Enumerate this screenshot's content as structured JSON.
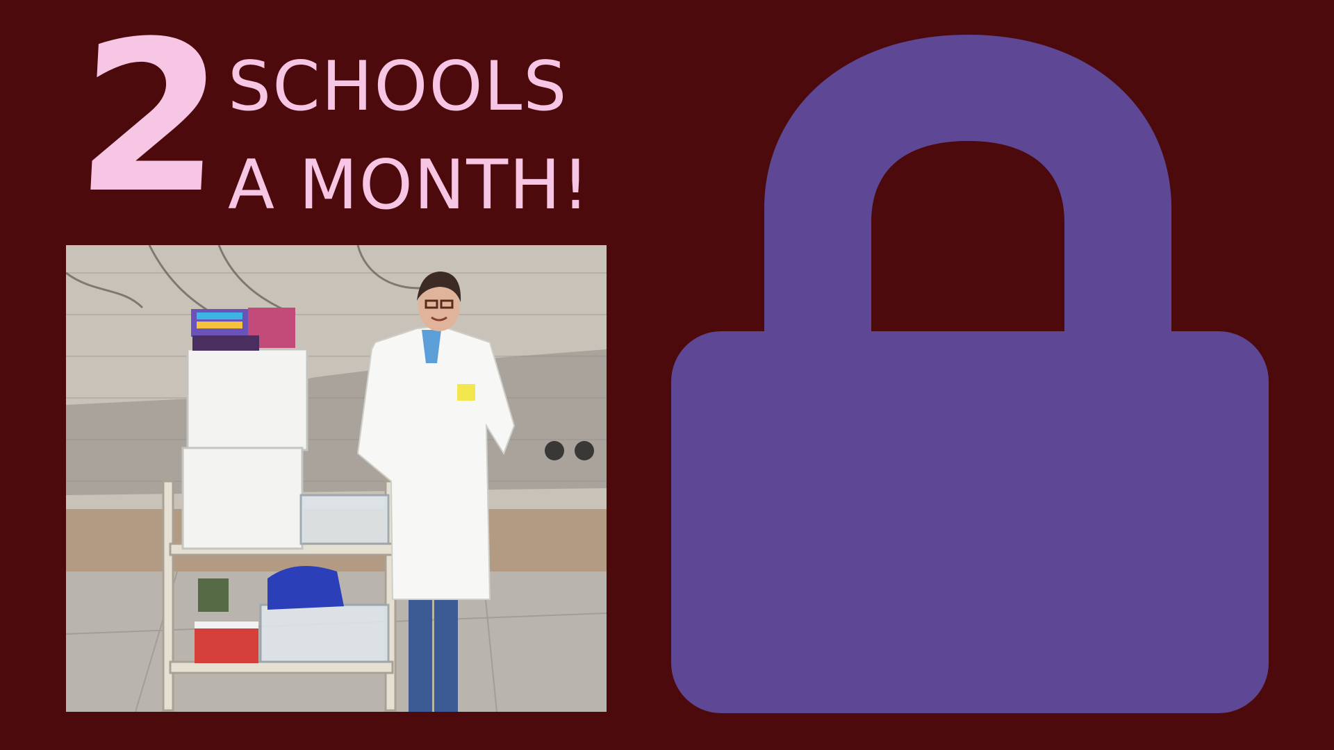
{
  "slide": {
    "number": "2",
    "line1": "SCHOOLS",
    "line2": "A MONTH!"
  },
  "photo": {
    "description_icon": "photo"
  },
  "icons": {
    "lock": "lock-icon"
  },
  "colors": {
    "background": "#4c0a0d",
    "text": "#f6c6e4",
    "lock": "#5e4795"
  }
}
